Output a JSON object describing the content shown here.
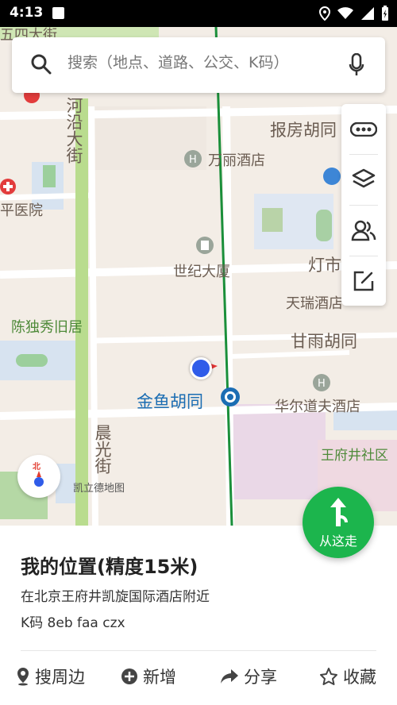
{
  "status_bar": {
    "time": "4:13"
  },
  "search": {
    "placeholder": "搜索（地点、道路、公交、K码）"
  },
  "map_labels": {
    "street_1": "五四大街",
    "street_2": "河沿大街",
    "hutong_1": "报房胡同",
    "hotel_1": "万丽酒店",
    "hospital": "和平医院",
    "building": "世纪大厦",
    "market": "灯市",
    "memorial": "陈独秀旧居",
    "hotel_2": "天瑞酒店",
    "hutong_2": "甘雨胡同",
    "station": "金鱼胡同",
    "hotel_3": "华尔道夫酒店",
    "street_3": "晨光街",
    "company": "凯立德地图",
    "community": "王府井社区"
  },
  "compass": {
    "label": "北"
  },
  "go_button": {
    "label": "从这走"
  },
  "location_panel": {
    "title": "我的位置(精度15米)",
    "address": "在北京王府井凯旋国际酒店附近",
    "kcode": "K码 8eb faa czx"
  },
  "actions": {
    "nearby": "搜周边",
    "add": "新增",
    "share": "分享",
    "favorite": "收藏"
  }
}
